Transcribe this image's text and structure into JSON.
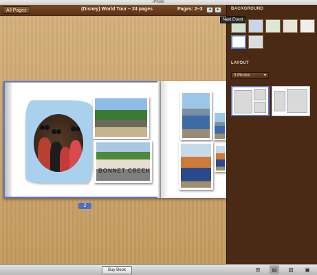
{
  "app": {
    "title": "iPhoto"
  },
  "toolbar": {
    "all_pages_label": "All Pages",
    "book_title": "(Disney) World Tour – 24 pages",
    "pages_label": "Pages: 2–3",
    "prev_icon": "◂",
    "next_icon": "▸"
  },
  "tooltip": {
    "text": "Next Event"
  },
  "book": {
    "left_page": {
      "sign_caption": "BONNET CREEK",
      "page_number": "2"
    }
  },
  "sidebar": {
    "background_label": "BACKGROUND",
    "background_swatches": [
      "#cfe2cf",
      "#c8d4e8",
      "#dfe7d4",
      "#e8e4d6",
      "#efefea",
      "#ffffff",
      "#d9dde0"
    ],
    "layout_label": "LAYOUT",
    "layout_select_value": "3 Photos",
    "caret_icon": "▾"
  },
  "bottombar": {
    "buy_book_label": "Buy Book",
    "icons": [
      "add-page-icon",
      "layout-icon",
      "photos-icon",
      "themes-icon"
    ]
  },
  "colors": {
    "selection_accent": "#5a78c8",
    "sidebar_bg": "#4a2a14"
  }
}
